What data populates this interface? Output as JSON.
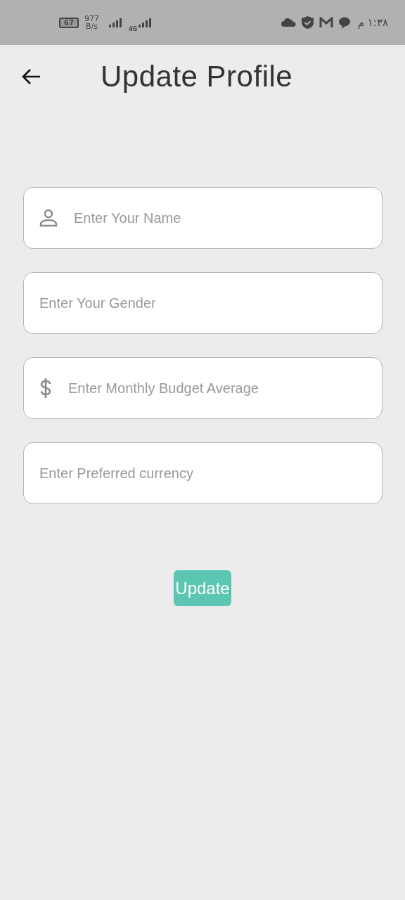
{
  "status_bar": {
    "battery": "67",
    "speed_value": "977",
    "speed_unit": "B/s",
    "network": "4G",
    "time": "١:٣٨ م"
  },
  "header": {
    "title": "Update Profile"
  },
  "fields": [
    {
      "placeholder": "Enter Your Name",
      "kind": "person"
    },
    {
      "placeholder": "Enter Your Gender",
      "kind": "plain"
    },
    {
      "placeholder": "Enter Monthly Budget Average",
      "kind": "money"
    },
    {
      "placeholder": "Enter Preferred currency",
      "kind": "plain"
    }
  ],
  "button": {
    "label": "Update"
  }
}
